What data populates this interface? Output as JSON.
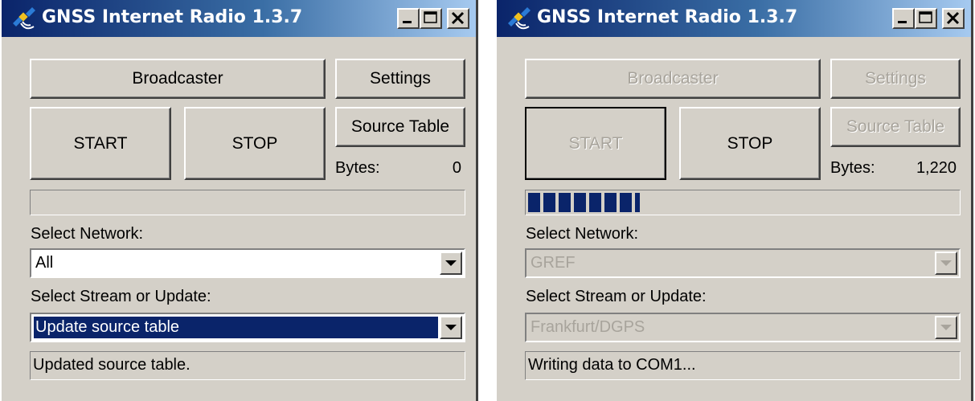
{
  "windows": [
    {
      "title": "GNSS Internet Radio 1.3.7",
      "buttons": {
        "broadcaster": "Broadcaster",
        "settings": "Settings",
        "start": "START",
        "stop": "STOP",
        "source_table": "Source Table"
      },
      "bytes_label": "Bytes:",
      "bytes_value": "0",
      "progress_fraction": 0,
      "network_label": "Select Network:",
      "network_value": "All",
      "stream_label": "Select Stream or Update:",
      "stream_value": "Update source table",
      "status": "Updated source table."
    },
    {
      "title": "GNSS Internet Radio 1.3.7",
      "buttons": {
        "broadcaster": "Broadcaster",
        "settings": "Settings",
        "start": "START",
        "stop": "STOP",
        "source_table": "Source Table"
      },
      "bytes_label": "Bytes:",
      "bytes_value": "1,220",
      "progress_fraction": 0.26,
      "network_label": "Select Network:",
      "network_value": "GREF",
      "stream_label": "Select Stream or Update:",
      "stream_value": "Frankfurt/DGPS",
      "status": "Writing data to COM1..."
    }
  ],
  "icons": {
    "app": "satellite-icon",
    "minimize": "minimize-icon",
    "maximize": "maximize-icon",
    "close": "close-icon",
    "dropdown": "chevron-down-icon"
  },
  "colors": {
    "title_bar_start": "#0a246a",
    "title_bar_end": "#a6caf0",
    "face": "#d4d0c8",
    "selection": "#0a246a",
    "progress": "#0a246a"
  }
}
